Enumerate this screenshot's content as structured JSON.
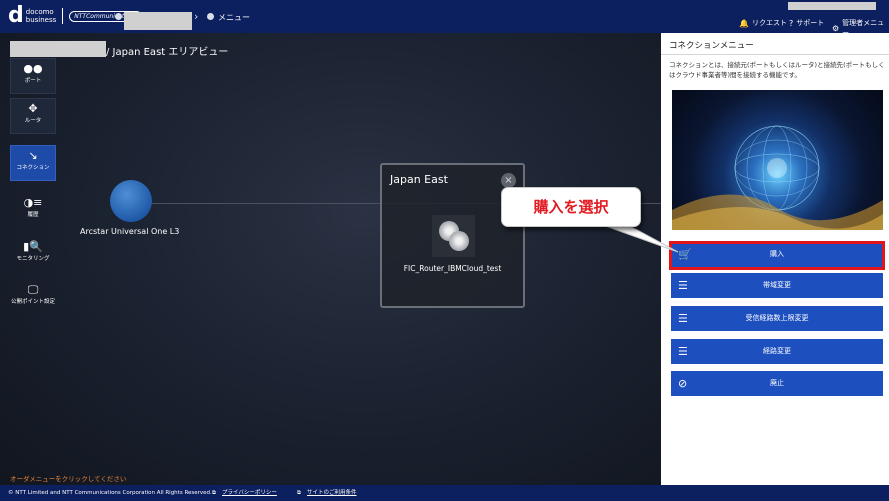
{
  "header": {
    "brand_line1": "docomo",
    "brand_line2": "business",
    "ntt_badge": "NTTCommunications",
    "menu_label": "メニュー",
    "nav": [
      {
        "label": "リクエスト",
        "icon": "bell-icon"
      },
      {
        "label": "サポート",
        "icon": "help-icon"
      },
      {
        "label": "管理者メニュー",
        "icon": "gear-icon"
      }
    ]
  },
  "canvas": {
    "area_title": "/ Japan East エリアビュー",
    "sidebar": [
      {
        "label": "ポート",
        "icon": "port-icon"
      },
      {
        "label": "ルータ",
        "icon": "router-icon"
      },
      {
        "label": "コネクション",
        "icon": "connection-icon"
      },
      {
        "label": "履歴",
        "icon": "history-icon"
      },
      {
        "label": "モニタリング",
        "icon": "monitoring-icon"
      },
      {
        "label": "公開ポイント設定",
        "icon": "monitor-icon"
      }
    ],
    "globe_label": "Arcstar Universal One L3",
    "region": {
      "title": "Japan East",
      "close": "×",
      "router_label": "FIC_Router_IBMCloud_test"
    },
    "callout": "購入を選択",
    "order_hint": "オーダメニューをクリックしてください"
  },
  "panel": {
    "title": "コネクションメニュー",
    "description": "コネクションとは、接続元(ポートもしくはルータ)と接続先(ポートもしくはクラウド事業者等)間を接続する機能です。",
    "buttons": [
      {
        "label": "購入",
        "icon": "cart-icon"
      },
      {
        "label": "帯域変更",
        "icon": "sliders-icon"
      },
      {
        "label": "受信経路数上限変更",
        "icon": "sliders-icon"
      },
      {
        "label": "経路変更",
        "icon": "sliders-icon"
      },
      {
        "label": "廃止",
        "icon": "prohibit-icon"
      }
    ]
  },
  "footer": {
    "copyright": "© NTT Limited and NTT Communications Corporation All Rights Reserved.",
    "privacy": "プライバシーポリシー",
    "terms": "サイトのご利用条件"
  },
  "colors": {
    "header_bg": "#0c1f5e",
    "accent_blue": "#1d4fbf",
    "highlight_red": "#e2141c",
    "hint_orange": "#e8843a"
  }
}
